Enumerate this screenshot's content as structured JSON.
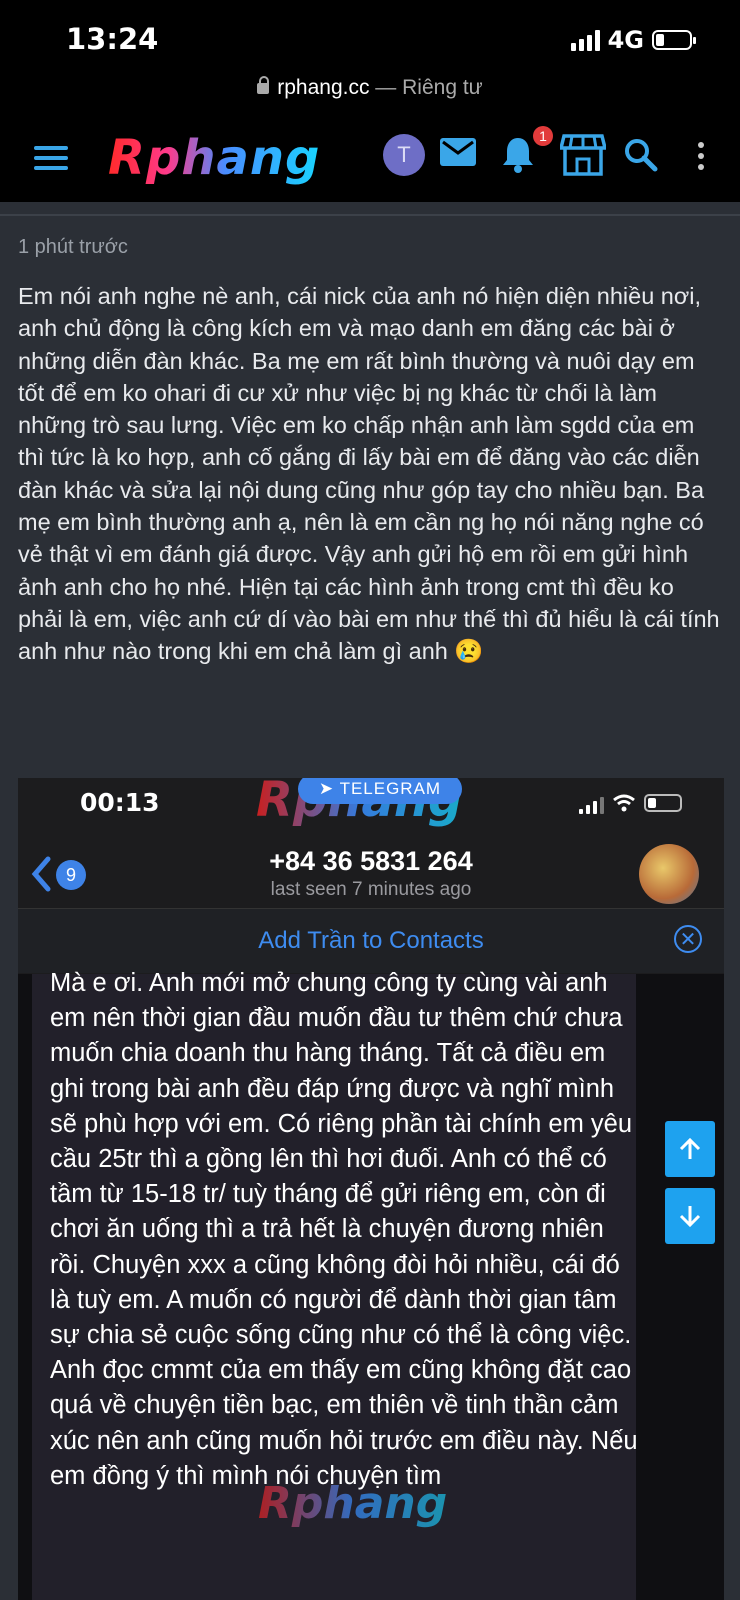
{
  "status_bar": {
    "time": "13:24",
    "network": "4G"
  },
  "url_bar": {
    "domain": "rphang.cc",
    "separator": " — ",
    "privacy": "Riêng tư"
  },
  "nav": {
    "logo": "Rphang",
    "avatar_letter": "T",
    "notification_count": "1"
  },
  "post": {
    "timestamp": "1 phút trước",
    "body": "Em nói anh nghe nè anh, cái nick của anh nó hiện diện nhiều nơi, anh chủ động là công kích em và mạo danh em đăng các bài ở những diễn đàn khác. Ba mẹ em rất bình thường và nuôi dạy em tốt để em ko ohari đi cư xử như việc bị ng khác từ chối là làm những trò sau lưng. Việc em ko chấp nhận anh làm sgdd của em thì tức là ko hợp, anh cố gắng đi lấy bài em để đăng vào các diễn đàn khác và sửa lại nội dung cũng như góp tay cho nhiều bạn. Ba mẹ em bình thường anh ạ, nên là em cần ng họ nói năng nghe có vẻ thật vì em đánh giá được. Vậy anh gửi hộ em rồi em gửi hình ảnh anh cho họ nhé. Hiện tại các hình ảnh trong cmt thì đều ko phải là em, việc anh cứ dí vào bài em như thế thì đủ hiểu là cái tính anh như nào trong khi em chả làm gì anh 😢"
  },
  "embedded": {
    "time": "00:13",
    "watermark": "Rphang",
    "telegram_label": "TELEGRAM",
    "back_count": "9",
    "phone_number": "+84 36 5831 264",
    "last_seen": "last seen 7 minutes ago",
    "add_contacts": "Add Trần to Contacts",
    "message": "Mà e ơi. Anh mới mở chung công ty cùng vài anh em nên thời gian đầu muốn đầu tư thêm chứ chưa muốn chia doanh thu hàng tháng. Tất cả điều em ghi trong bài anh đều đáp ứng được và nghĩ mình sẽ phù hợp với em. Có riêng phần tài chính em yêu cầu 25tr thì a gồng lên thì hơi đuối. Anh có thể có tầm từ 15-18 tr/ tuỳ tháng để gửi riêng em, còn đi chơi ăn uống thì a trả hết là chuyện đương nhiên rồi. Chuyện xxx a cũng không đòi hỏi nhiều, cái đó là tuỳ em. A muốn có người để dành thời gian tâm sự chia sẻ cuộc sống cũng như có thể là công việc. Anh đọc cmmt của em thấy em cũng không đặt cao quá về chuyện tiền bạc, em thiên về tinh thần cảm xúc nên anh cũng muốn hỏi trước em điều này. Nếu em đồng ý thì mình nói chuyện tìm"
  },
  "colors": {
    "accent": "#3aa6e8",
    "badge": "#e23b3b",
    "background": "#2b2f36"
  }
}
